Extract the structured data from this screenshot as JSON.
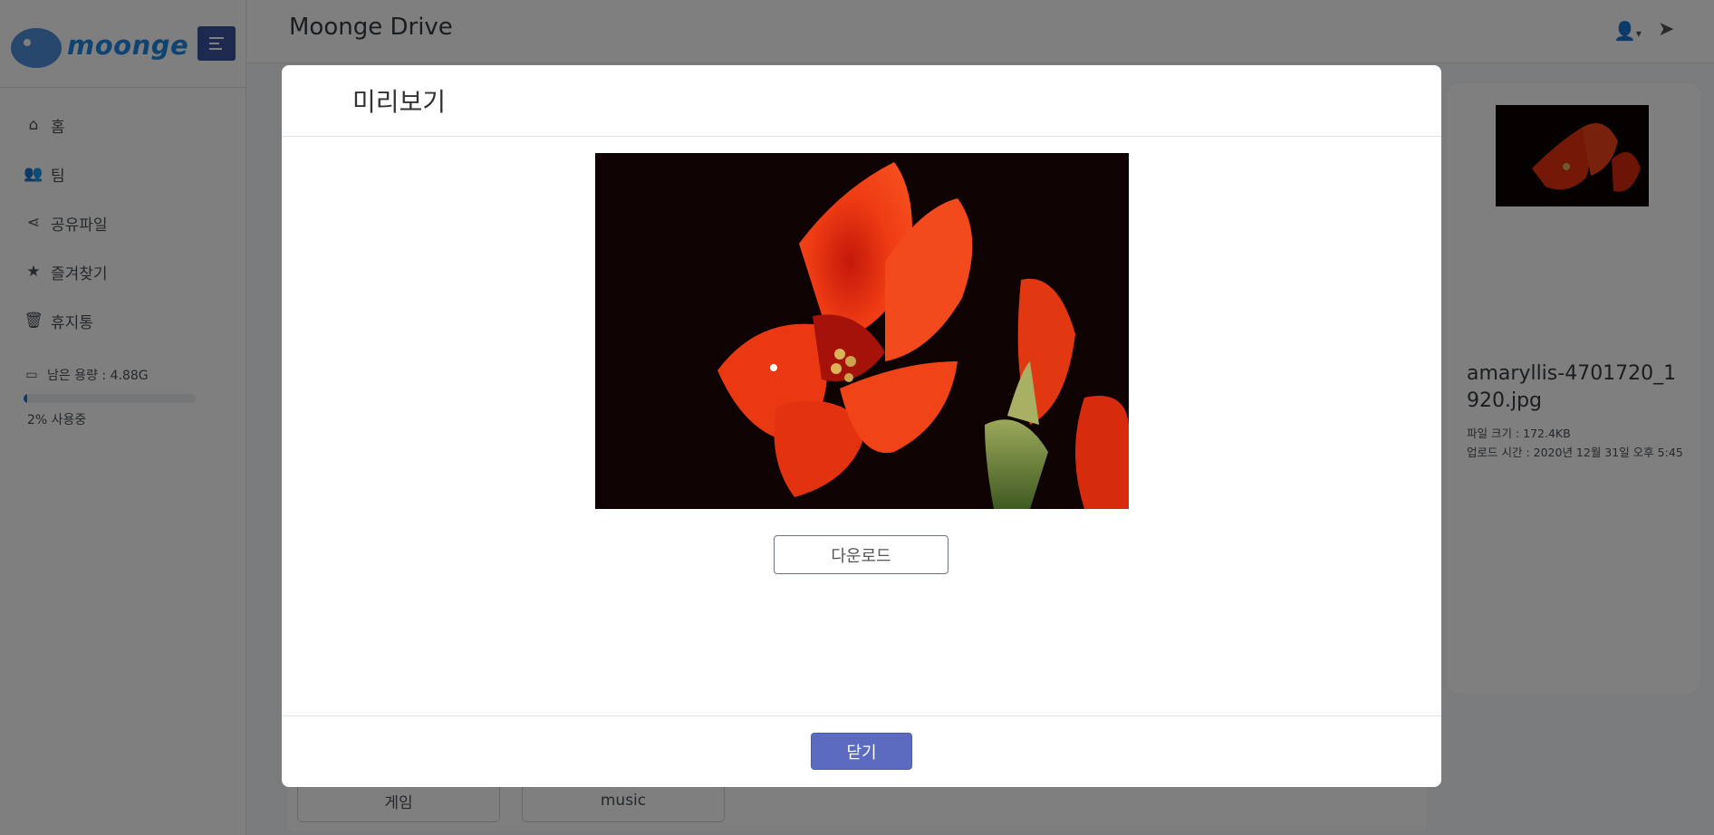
{
  "app": {
    "brand": "moonge",
    "title": "Moonge Drive"
  },
  "sidebar": {
    "items": [
      {
        "label": "홈",
        "icon": "home-icon"
      },
      {
        "label": "팀",
        "icon": "users-icon"
      },
      {
        "label": "공유파일",
        "icon": "share-icon"
      },
      {
        "label": "즐겨찾기",
        "icon": "star-icon"
      },
      {
        "label": "휴지통",
        "icon": "trash-icon"
      }
    ],
    "storage": {
      "label": "남은 용량 : 4.88G",
      "used_label": "2% 사용중",
      "used_fraction": 0.02,
      "icon": "hard-drive-icon"
    }
  },
  "folders": [
    {
      "label": "게임"
    },
    {
      "label": "music"
    }
  ],
  "detail": {
    "filename": "amaryllis-4701720_1920.jpg",
    "size": "파일 크기 : 172.4KB",
    "uploaded": "업로드 시간 : 2020년 12월 31일 오후 5:45"
  },
  "modal": {
    "title": "미리보기",
    "download_label": "다운로드",
    "close_label": "닫기"
  },
  "colors": {
    "accent": "#5c6bc0",
    "brand_blue": "#1e88e5",
    "progress": "#1976d2"
  }
}
